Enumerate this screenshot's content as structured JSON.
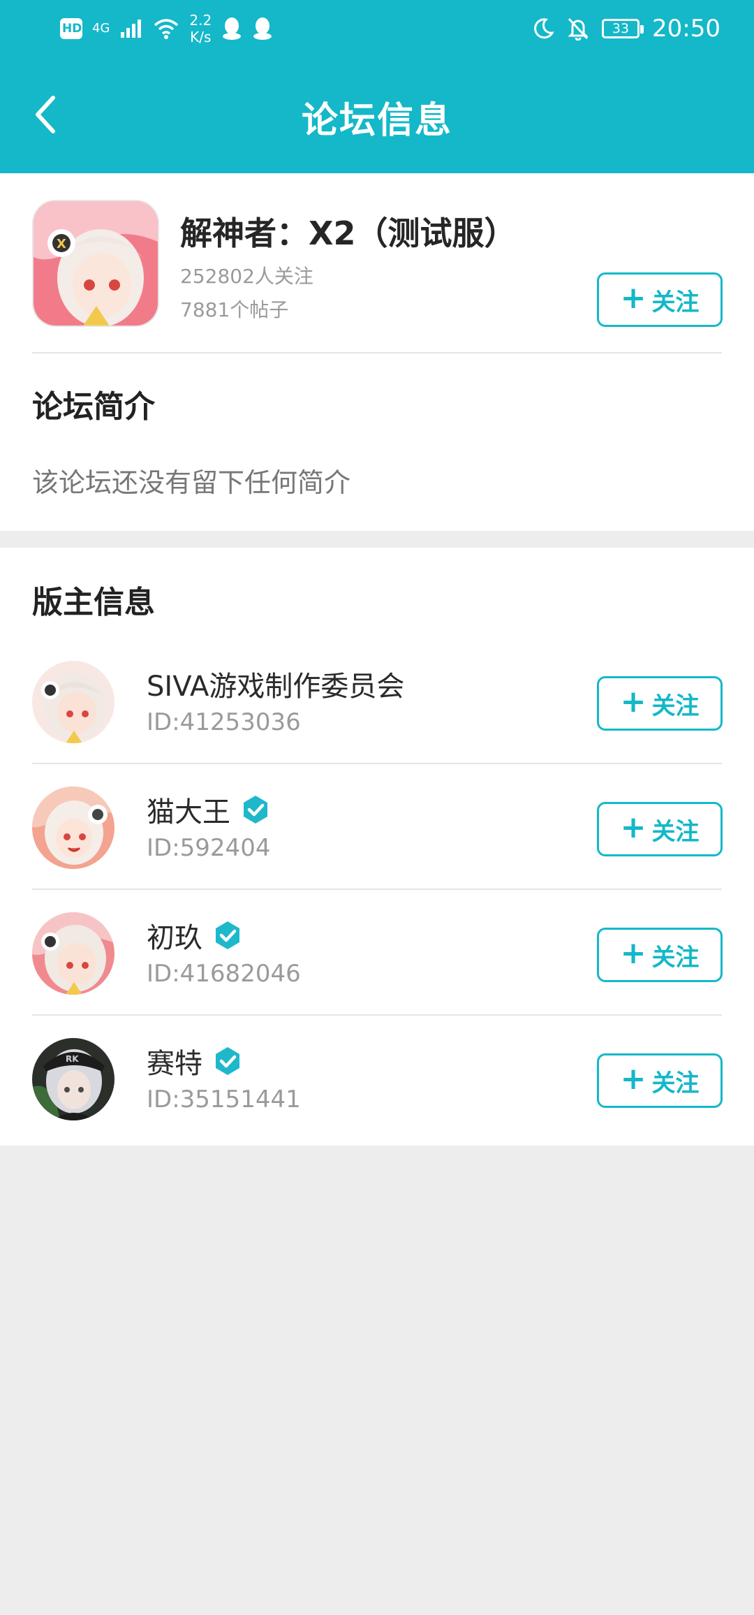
{
  "status_bar": {
    "hd": "HD",
    "network": "4G",
    "speed_value": "2.2",
    "speed_unit": "K/s",
    "battery": "33",
    "time": "20:50"
  },
  "header": {
    "title": "论坛信息"
  },
  "forum": {
    "name": "解神者：X2（测试服）",
    "followers": "252802人关注",
    "posts": "7881个帖子",
    "follow_label": "关注"
  },
  "intro": {
    "title": "论坛简介",
    "text": "该论坛还没有留下任何简介"
  },
  "moderators": {
    "title": "版主信息",
    "items": [
      {
        "name": "SIVA游戏制作委员会",
        "id": "ID:41253036",
        "verified": false,
        "follow_label": "关注"
      },
      {
        "name": "猫大王",
        "id": "ID:592404",
        "verified": true,
        "follow_label": "关注"
      },
      {
        "name": "初玖",
        "id": "ID:41682046",
        "verified": true,
        "follow_label": "关注"
      },
      {
        "name": "赛特",
        "id": "ID:35151441",
        "verified": true,
        "follow_label": "关注"
      }
    ]
  },
  "colors": {
    "accent": "#14b8c8",
    "background": "#ededed"
  },
  "icons": {
    "back": "chevron-left-icon",
    "verified": "verified-check-icon",
    "follow_plus": "plus-icon"
  }
}
